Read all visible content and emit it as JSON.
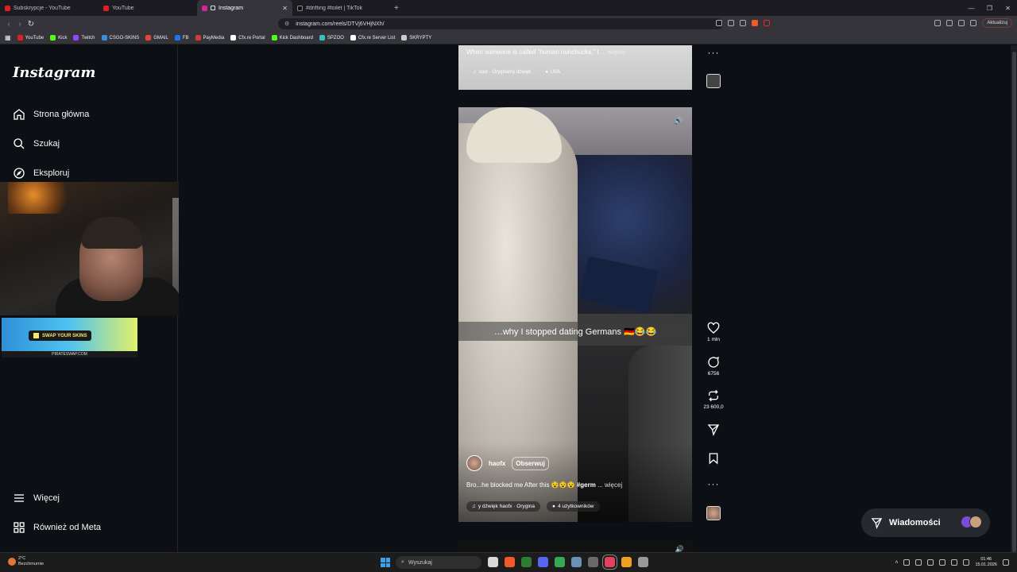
{
  "browser": {
    "tabs": [
      {
        "title": "Subskrypcje - YouTube",
        "color": "#e02020",
        "active": false
      },
      {
        "title": "YouTube",
        "color": "#e02020",
        "active": false
      },
      {
        "title": "Instagram",
        "color": "#d6249f",
        "active": true
      },
      {
        "title": "#drifting #toilet | TikTok",
        "color": "#111111",
        "active": false
      }
    ],
    "url": "instagram.com/reels/DTVj6VHjNXh/",
    "update_label": "Aktualizuj",
    "bookmarks": [
      {
        "label": "YouTube",
        "color": "#e02020"
      },
      {
        "label": "Kick",
        "color": "#53fc18"
      },
      {
        "label": "Twitch",
        "color": "#9146ff"
      },
      {
        "label": "CSGO-SKINS",
        "color": "#3a8fd8"
      },
      {
        "label": "GMAIL",
        "color": "#ea4335"
      },
      {
        "label": "FB",
        "color": "#1877f2"
      },
      {
        "label": "PayMedia",
        "color": "#d23b3b"
      },
      {
        "label": "Cfx.re Portal",
        "color": "#ffffff"
      },
      {
        "label": "Kick Dashboard",
        "color": "#53fc18"
      },
      {
        "label": "SPZOO",
        "color": "#36c0c0"
      },
      {
        "label": "Cfx.re Server List",
        "color": "#ffffff"
      },
      {
        "label": "SKRYPTY",
        "color": "#cccccc"
      }
    ]
  },
  "sidebar": {
    "logo": "Instagram",
    "items": [
      {
        "label": "Strona główna",
        "icon": "home-icon"
      },
      {
        "label": "Szukaj",
        "icon": "search-icon"
      },
      {
        "label": "Eksploruj",
        "icon": "compass-icon"
      },
      {
        "label": "Więcej",
        "icon": "menu-icon"
      },
      {
        "label": "Również od Meta",
        "icon": "meta-icon"
      }
    ]
  },
  "banner": {
    "label": "SWAP YOUR SKINS",
    "site": "PIRATESWAP.COM"
  },
  "prev_reel": {
    "caption": "When someone is called \"human nunchucks,\" I",
    "more": "... więcej",
    "audio": "sour · Oryginalny dźwięk",
    "location": "USA"
  },
  "reel": {
    "overlay_text": "…why I stopped dating Germans 🇩🇪😂😂",
    "author": "haofx",
    "follow_label": "Obserwuj",
    "description": "Bro...he blocked me After this 😵😵😵",
    "hashtag": "#germ",
    "more": "... więcej",
    "audio": "y dźwięk  haofx · Orygina",
    "users": "4 użytkowników"
  },
  "actions": {
    "likes": "1 mln",
    "comments": "6756",
    "reposts": "23 600,0"
  },
  "messages": {
    "label": "Wiadomości"
  },
  "taskbar": {
    "weather_temp": "2°C",
    "weather_desc": "Bezchmurnie",
    "search_placeholder": "Wyszukaj",
    "time": "01:46",
    "date": "15.01.2026"
  }
}
